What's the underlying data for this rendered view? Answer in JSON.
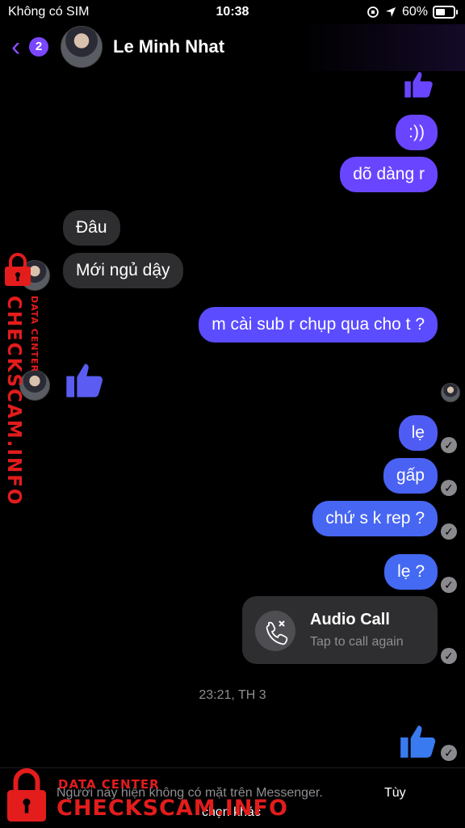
{
  "status_bar": {
    "carrier": "Không có SIM",
    "time": "10:38",
    "battery": "60%",
    "battery_level": 0.6
  },
  "header": {
    "back_badge_count": "2",
    "contact_name": "Le Minh Nhat"
  },
  "messages": {
    "m1": ":))",
    "m2": "dõ dàng r",
    "m3": "Đâu",
    "m4": "Mới ngủ dậy",
    "m5": "m cài sub r chụp qua cho t ?",
    "m6": "lẹ",
    "m7": "gấp",
    "m8": "chứ s k rep ?",
    "m9": "lẹ ?"
  },
  "call_card": {
    "title": "Audio Call",
    "subtitle": "Tap to call again"
  },
  "timestamp": "23:21, TH 3",
  "footer": {
    "message": "Người này hiện không có mặt trên Messenger.",
    "action_line1": "Tùy",
    "action_line2": "chọn khác"
  },
  "watermark": {
    "line_small": "DATA CENTER",
    "line_big": "CHECKSCAM.INFO"
  },
  "colors": {
    "accent": "#6a45ff",
    "incoming_bubble": "#2e2e30",
    "like_blue": "#5a5cf2",
    "watermark_red": "#e31c1c"
  }
}
